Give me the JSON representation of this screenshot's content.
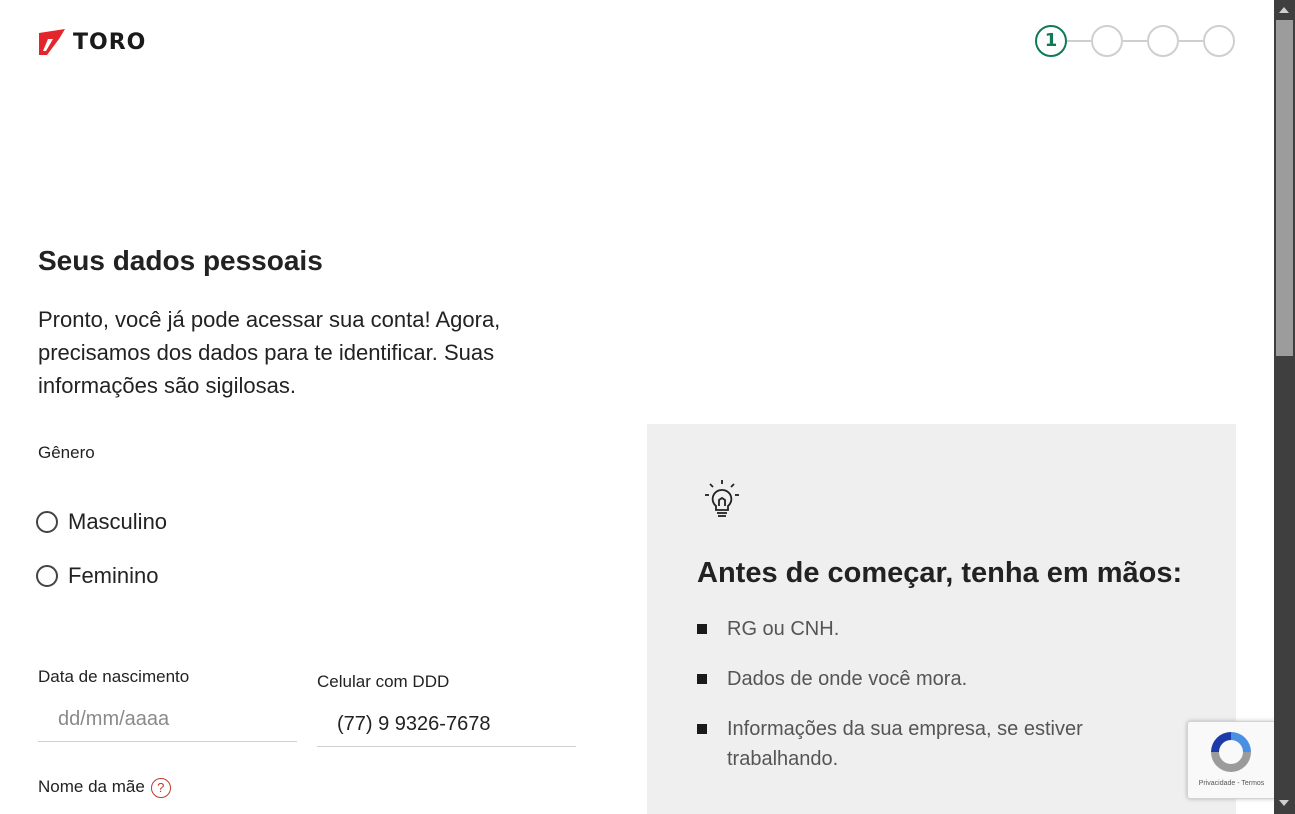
{
  "brand": {
    "name": "TORO",
    "accent_color": "#e3262b"
  },
  "stepper": {
    "active_step": "1",
    "total_steps": 4,
    "active_color": "#0f7a55"
  },
  "section": {
    "title": "Seus dados pessoais",
    "intro": "Pronto, você já pode acessar sua conta! Agora, precisamos dos dados para te identificar. Suas informações são sigilosas."
  },
  "gender": {
    "label": "Gênero",
    "options": [
      {
        "label": "Masculino",
        "selected": false
      },
      {
        "label": "Feminino",
        "selected": false
      }
    ]
  },
  "birth_date": {
    "label": "Data de nascimento",
    "placeholder": "dd/mm/aaaa",
    "value": ""
  },
  "phone": {
    "label": "Celular com DDD",
    "value": "(77) 9 9326-7678"
  },
  "mother_name": {
    "label": "Nome da mãe",
    "help_icon": "question-icon"
  },
  "tips": {
    "icon": "lightbulb-icon",
    "title": "Antes de começar, tenha em mãos:",
    "items": [
      "RG ou CNH.",
      "Dados de onde você mora.",
      "Informações da sua empresa, se estiver trabalhando."
    ]
  },
  "recaptcha": {
    "links": "Privacidade - Termos"
  }
}
